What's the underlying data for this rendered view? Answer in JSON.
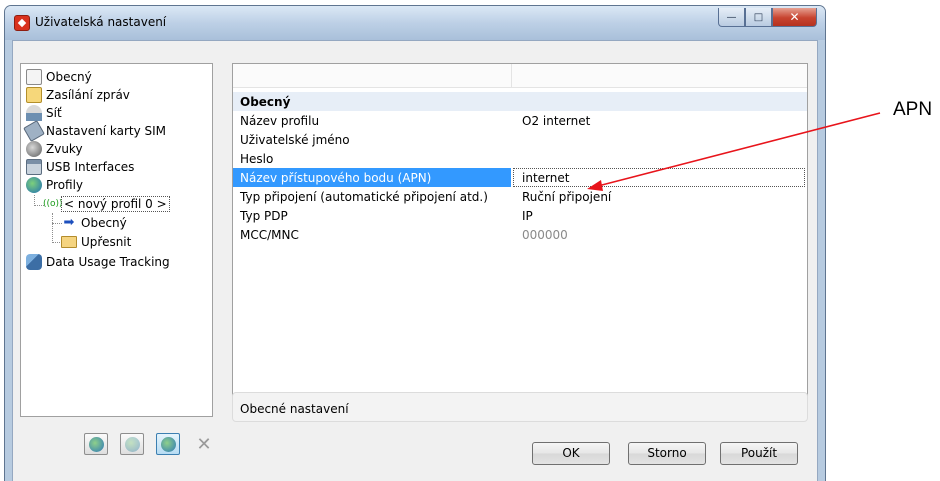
{
  "window": {
    "title": "Uživatelská nastavení",
    "controls": {
      "minimize": "—",
      "maximize": "□",
      "close": "✕"
    }
  },
  "tree": {
    "items": [
      {
        "label": "Obecný",
        "icon": "general-settings-icon"
      },
      {
        "label": "Zasílání zpráv",
        "icon": "envelope-icon"
      },
      {
        "label": "Síť",
        "icon": "network-icon"
      },
      {
        "label": "Nastavení karty SIM",
        "icon": "sim-card-icon"
      },
      {
        "label": "Zvuky",
        "icon": "speaker-icon"
      },
      {
        "label": "USB Interfaces",
        "icon": "usb-icon"
      },
      {
        "label": "Profily",
        "icon": "globe-icon"
      },
      {
        "label": "< nový profil 0 >",
        "icon": "antenna-icon",
        "antenna_text": "((o))"
      },
      {
        "label": "Obecný",
        "icon": "arrow-right-icon",
        "icon_glyph": "➡"
      },
      {
        "label": "Upřesnit",
        "icon": "folder-icon"
      },
      {
        "label": "Data Usage Tracking",
        "icon": "data-usage-icon"
      }
    ]
  },
  "grid": {
    "group": "Obecný",
    "rows": [
      {
        "name": "Název profilu",
        "value": "O2 internet"
      },
      {
        "name": "Uživatelské jméno",
        "value": ""
      },
      {
        "name": "Heslo",
        "value": ""
      },
      {
        "name": "Název přístupového bodu (APN)",
        "value": "internet",
        "selected": true
      },
      {
        "name": "Typ připojení (automatické připojení atd.)",
        "value": "Ruční připojení"
      },
      {
        "name": "Typ PDP",
        "value": "IP"
      },
      {
        "name": "MCC/MNC",
        "value": "000000",
        "muted": true
      }
    ]
  },
  "description": "Obecné nastavení",
  "toolbar": {
    "delete_glyph": "✕"
  },
  "buttons": {
    "ok": "OK",
    "cancel": "Storno",
    "apply": "Použít"
  },
  "annotation": {
    "label": "APN",
    "color": "#e8141b"
  }
}
